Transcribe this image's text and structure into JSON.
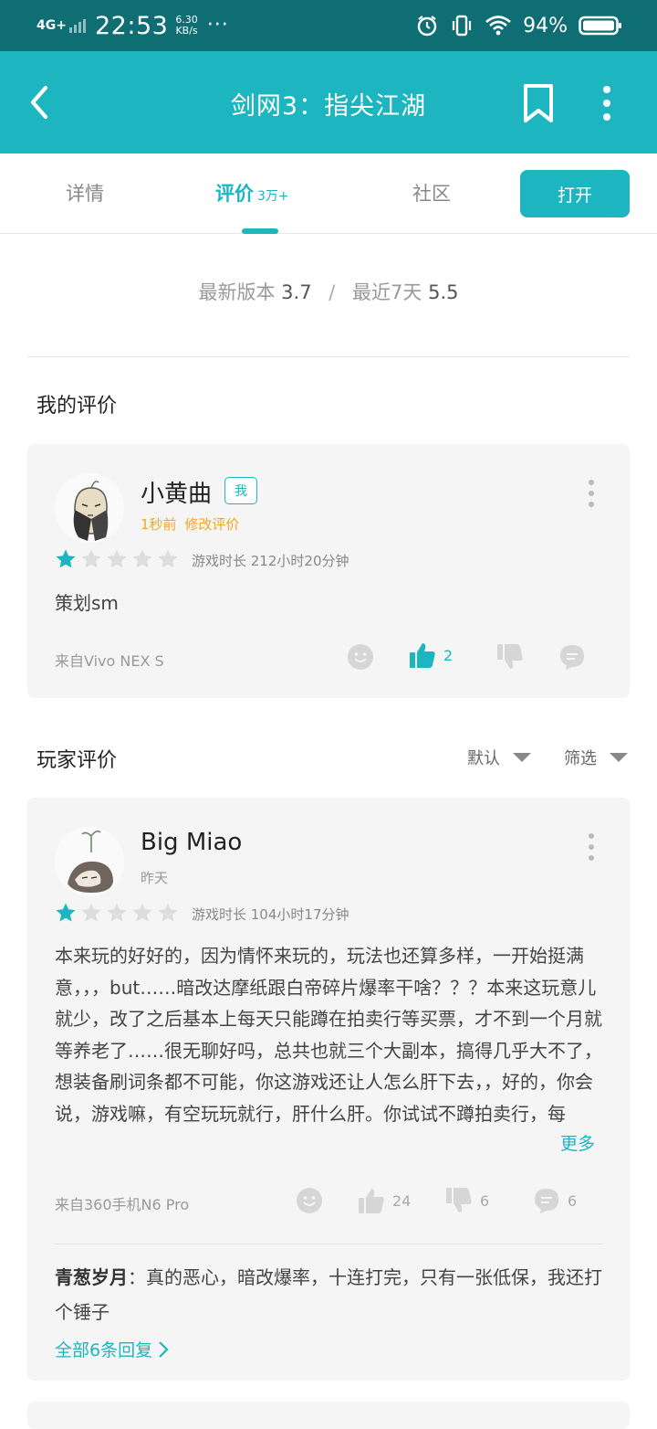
{
  "status_bar": {
    "network": "4G+",
    "time": "22:53",
    "speed_value": "6.30",
    "speed_unit": "KB/s",
    "more": "···",
    "battery_percent": "94%",
    "icons": [
      "alarm-icon",
      "vibrate-icon",
      "wifi-icon",
      "battery-icon"
    ]
  },
  "header": {
    "title": "剑网3：指尖江湖",
    "icons": [
      "back-arrow-icon",
      "bookmark-icon",
      "more-vertical-icon"
    ]
  },
  "tabs": {
    "items": [
      {
        "label": "详情"
      },
      {
        "label": "评价",
        "count": "3万+",
        "active": true
      },
      {
        "label": "社区"
      }
    ],
    "open_button": "打开"
  },
  "rating_summary": {
    "latest_label": "最新版本",
    "latest_value": "3.7",
    "separator": "/",
    "recent_label": "最近7天",
    "recent_value": "5.5"
  },
  "my_review": {
    "section_title": "我的评价",
    "user": "小黄曲",
    "badge": "我",
    "time": "1秒前",
    "edit_label": "修改评价",
    "stars": 1,
    "max_stars": 5,
    "playtime": "游戏时长 212小时20分钟",
    "content": "策划sm",
    "device": "来自Vivo NEX S",
    "like_count": "2"
  },
  "player_reviews": {
    "section_title": "玩家评价",
    "sort_label": "默认",
    "filter_label": "筛选",
    "items": [
      {
        "user": "Big Miao",
        "time": "昨天",
        "stars": 1,
        "max_stars": 5,
        "playtime": "游戏时长 104小时17分钟",
        "content": "本来玩的好好的，因为情怀来玩的，玩法也还算多样，一开始挺满意，，，but……暗改达摩纸跟白帝碎片爆率干啥？？？本来这玩意儿就少，改了之后基本上每天只能蹲在拍卖行等买票，才不到一个月就等养老了……很无聊好吗，总共也就三个大副本，搞得几乎大不了，想装备刷词条都不可能，你这游戏还让人怎么肝下去，，好的，你会说，游戏嘛，有空玩玩就行，肝什么肝。你试试不蹲拍卖行，每",
        "more_label": "更多",
        "device": "来自360手机N6 Pro",
        "like_count": "24",
        "dislike_count": "6",
        "comment_count": "6",
        "reply": {
          "name": "青葱岁月",
          "separator": "：",
          "text": "真的恶心，暗改爆率，十连打完，只有一张低保，我还打个锤子"
        },
        "all_replies_label": "全部6条回复"
      }
    ]
  },
  "colors": {
    "accent": "#1cb5c0",
    "status_bar": "#0f6e74",
    "star_on": "#1cb5c0",
    "star_off": "#dddddd",
    "time_orange": "#f5a623",
    "card_bg": "#f5f5f5"
  }
}
